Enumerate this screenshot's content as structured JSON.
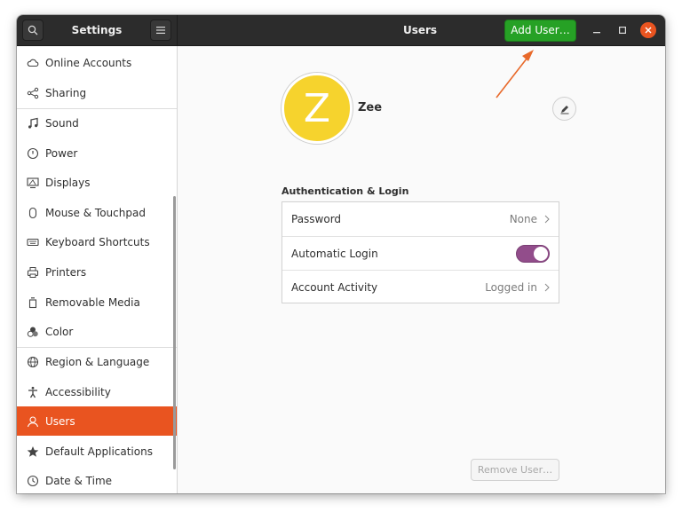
{
  "header": {
    "left_title": "Settings",
    "main_title": "Users",
    "add_user_label": "Add User…"
  },
  "sidebar": {
    "items": [
      {
        "label": "Online Accounts",
        "icon": "cloud-icon"
      },
      {
        "label": "Sharing",
        "icon": "share-icon"
      },
      {
        "label": "Sound",
        "icon": "music-note-icon"
      },
      {
        "label": "Power",
        "icon": "power-icon"
      },
      {
        "label": "Displays",
        "icon": "display-icon"
      },
      {
        "label": "Mouse & Touchpad",
        "icon": "mouse-icon"
      },
      {
        "label": "Keyboard Shortcuts",
        "icon": "keyboard-icon"
      },
      {
        "label": "Printers",
        "icon": "printer-icon"
      },
      {
        "label": "Removable Media",
        "icon": "removable-media-icon"
      },
      {
        "label": "Color",
        "icon": "color-icon"
      },
      {
        "label": "Region & Language",
        "icon": "globe-icon"
      },
      {
        "label": "Accessibility",
        "icon": "accessibility-icon"
      },
      {
        "label": "Users",
        "icon": "user-icon",
        "active": true
      },
      {
        "label": "Default Applications",
        "icon": "star-icon"
      },
      {
        "label": "Date & Time",
        "icon": "clock-icon"
      }
    ]
  },
  "user": {
    "avatar_letter": "Z",
    "name": "Zee",
    "avatar_color": "#f6d32d"
  },
  "auth": {
    "section_title": "Authentication & Login",
    "password_label": "Password",
    "password_value": "None",
    "auto_login_label": "Automatic Login",
    "auto_login_enabled": true,
    "activity_label": "Account Activity",
    "activity_value": "Logged in"
  },
  "remove_user_label": "Remove User…",
  "colors": {
    "accent": "#e95420",
    "add_button": "#26a125",
    "toggle_on": "#924d8b"
  }
}
